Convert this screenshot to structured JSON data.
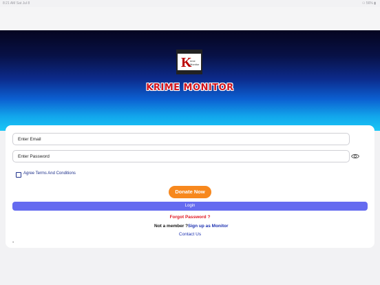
{
  "status_bar": {
    "left": "8:21 AM   Sat Jul 8",
    "right": "⚇ 56% ▮"
  },
  "brand": {
    "name": "KRIME MONITOR",
    "logo_letter": "K",
    "logo_small_text": "rime Monitor"
  },
  "form": {
    "email_placeholder": "Enter Email",
    "password_placeholder": "Enter Password",
    "terms_label": "Agree Terms And Conditions"
  },
  "buttons": {
    "donate": "Donate Now",
    "login": "Login",
    "forgot": "Forgot Password ?"
  },
  "footer": {
    "member_text": "Not a member ?",
    "signup": "Sign up as Monitor",
    "contact": "Contact Us",
    "dot": "-"
  },
  "colors": {
    "brand_red": "#d0141d",
    "donate_orange": "#f7881e",
    "login_blue": "#656bf0",
    "link_blue": "#1a2fb0",
    "forgot_red": "#e0141f"
  }
}
